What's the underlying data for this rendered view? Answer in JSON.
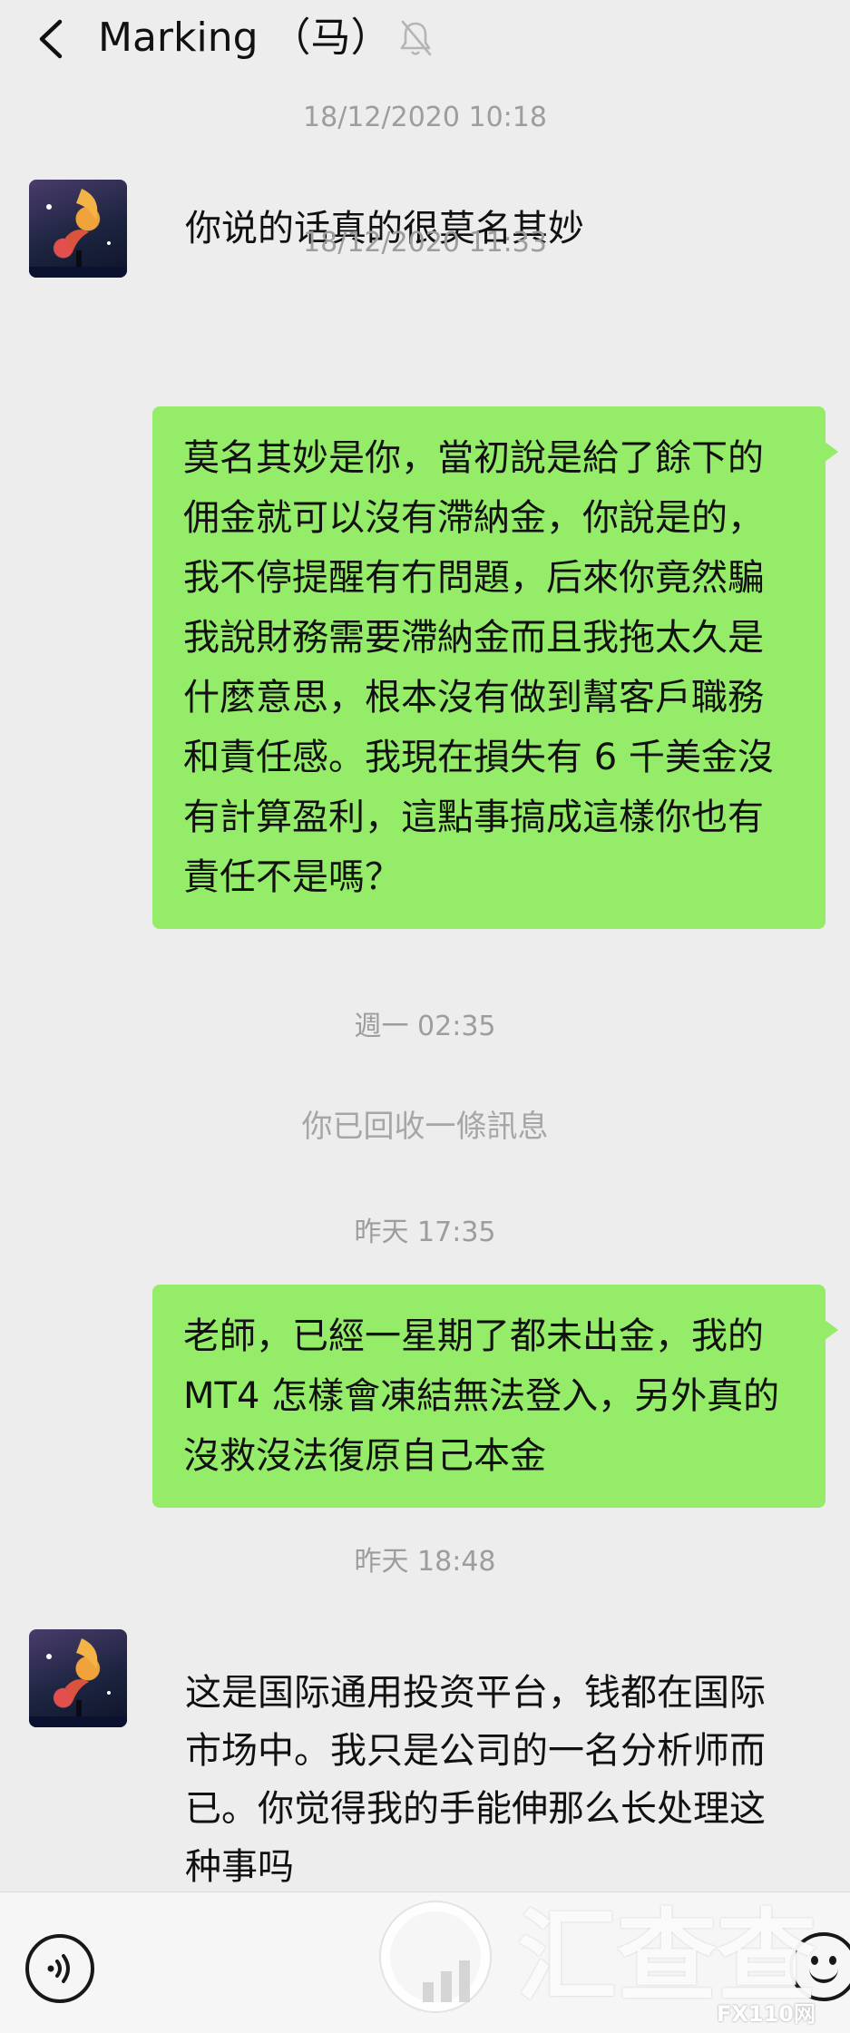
{
  "header": {
    "title": "Marking （马）",
    "back_icon": "chevron-left-icon",
    "mute_icon": "bell-off-icon"
  },
  "messages": [
    {
      "type": "time",
      "text": "18/12/2020 10:18"
    },
    {
      "type": "received",
      "text": "你说的话真的很莫名其妙"
    },
    {
      "type": "time",
      "text": "18/12/2020 11:33"
    },
    {
      "type": "sent",
      "text": "莫名其妙是你，當初說是給了餘下的佣金就可以沒有滯納金，你說是的，我不停提醒有冇問題，后來你竟然騙我說財務需要滯納金而且我拖太久是什麼意思，根本沒有做到幫客戶職務和責任感。我現在損失有 6 千美金沒有計算盈利，這點事搞成這樣你也有責任不是嗎？"
    },
    {
      "type": "time",
      "text": "週一 02:35"
    },
    {
      "type": "system",
      "text": "你已回收一條訊息"
    },
    {
      "type": "time",
      "text": "昨天 17:35"
    },
    {
      "type": "sent",
      "text": "老師，已經一星期了都未出金，我的 MT4 怎樣會凍結無法登入，另外真的沒救沒法復原自己本金"
    },
    {
      "type": "time",
      "text": "昨天 18:48"
    },
    {
      "type": "received",
      "text": "这是国际通用投资平台，钱都在国际市场中。我只是公司的一名分析师而已。你觉得我的手能伸那么长处理这种事吗"
    }
  ],
  "bottom_bar": {
    "voice_icon": "voice-icon",
    "emoji_icon": "emoji-icon"
  },
  "watermark": {
    "text": "汇查查",
    "corner": "FX110网"
  },
  "colors": {
    "background": "#ededed",
    "sent_bubble": "#95ec69"
  }
}
